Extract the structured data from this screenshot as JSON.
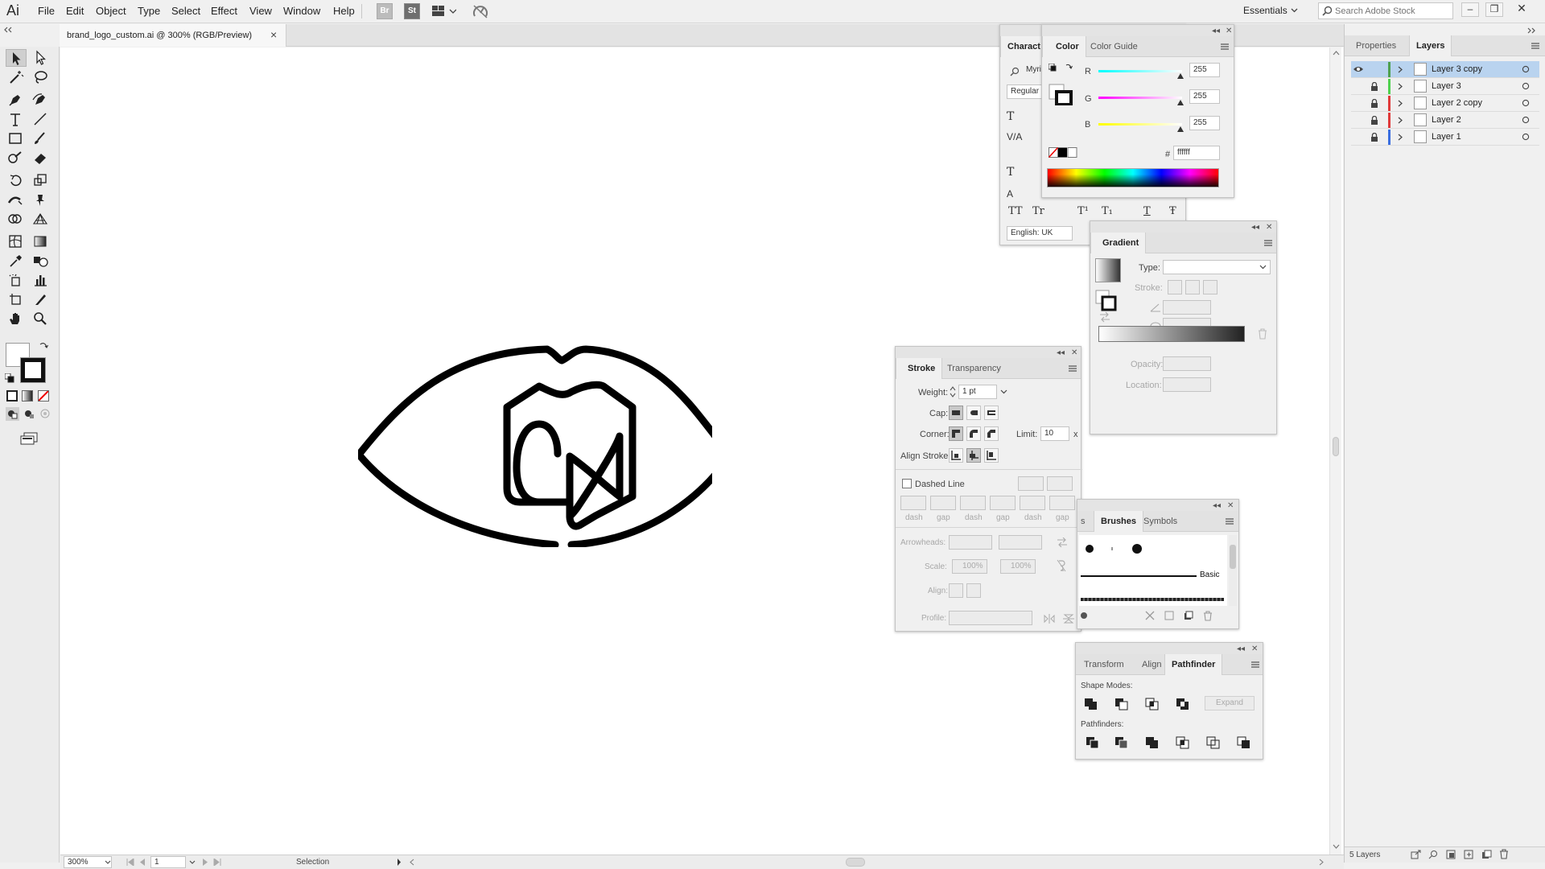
{
  "app": {
    "logo": "Ai"
  },
  "menu": [
    "File",
    "Edit",
    "Object",
    "Type",
    "Select",
    "Effect",
    "View",
    "Window",
    "Help"
  ],
  "workspace_buttons": {
    "bridge": "Br",
    "stock": "St"
  },
  "workspace": "Essentials",
  "search": {
    "placeholder": "Search Adobe Stock"
  },
  "document_tab": {
    "title": "brand_logo_custom.ai @ 300% (RGB/Preview)",
    "close": "×"
  },
  "character_panel": {
    "tab": "Charact",
    "font": "Myri",
    "style": "Regular",
    "language": "English: UK",
    "glyph_labels": [
      "TT",
      "Tr",
      "T¹",
      "T₁",
      "T",
      "Ŧ"
    ]
  },
  "color_panel": {
    "tabs": [
      "Color",
      "Color Guide"
    ],
    "channels": [
      {
        "name": "R",
        "value": "255"
      },
      {
        "name": "G",
        "value": "255"
      },
      {
        "name": "B",
        "value": "255"
      }
    ],
    "hex_label": "#",
    "hex": "ffffff"
  },
  "gradient_panel": {
    "title": "Gradient",
    "type_label": "Type:",
    "stroke_label": "Stroke:",
    "opacity_label": "Opacity:",
    "location_label": "Location:"
  },
  "stroke_panel": {
    "tabs": [
      "Stroke",
      "Transparency"
    ],
    "weight_label": "Weight:",
    "weight": "1 pt",
    "cap_label": "Cap:",
    "corner_label": "Corner:",
    "limit_label": "Limit:",
    "limit": "10",
    "limit_unit": "x",
    "align_label": "Align Stroke:",
    "dashed_label": "Dashed Line",
    "dash_labels": [
      "dash",
      "gap",
      "dash",
      "gap",
      "dash",
      "gap"
    ],
    "arrowheads_label": "Arrowheads:",
    "scale_label": "Scale:",
    "scale1": "100%",
    "scale2": "100%",
    "align2_label": "Align:",
    "profile_label": "Profile:"
  },
  "brushes_panel": {
    "tabs": [
      "s",
      "Brushes",
      "Symbols"
    ],
    "basic_label": "Basic"
  },
  "pathfinder_panel": {
    "tabs": [
      "Transform",
      "Align",
      "Pathfinder"
    ],
    "shape_modes": "Shape Modes:",
    "expand": "Expand",
    "pathfinders": "Pathfinders:"
  },
  "right_dock": {
    "tabs": [
      "Properties",
      "Layers"
    ],
    "layers": [
      {
        "name": "Layer 3 copy",
        "color": "#4fa04f",
        "visible": true,
        "locked": false,
        "selected": true
      },
      {
        "name": "Layer 3",
        "color": "#4fd24f",
        "visible": false,
        "locked": true,
        "selected": false
      },
      {
        "name": "Layer 2 copy",
        "color": "#e03a3a",
        "visible": false,
        "locked": true,
        "selected": false
      },
      {
        "name": "Layer 2",
        "color": "#e03a3a",
        "visible": false,
        "locked": true,
        "selected": false
      },
      {
        "name": "Layer 1",
        "color": "#3a6ee0",
        "visible": false,
        "locked": true,
        "selected": false
      }
    ],
    "footer": "5 Layers"
  },
  "status": {
    "zoom": "300%",
    "artboard": "1",
    "tool": "Selection"
  },
  "colors": {
    "accent_selected": "#b9d3ef",
    "canvas": "#ffffff",
    "ui": "#f0f0f0"
  }
}
